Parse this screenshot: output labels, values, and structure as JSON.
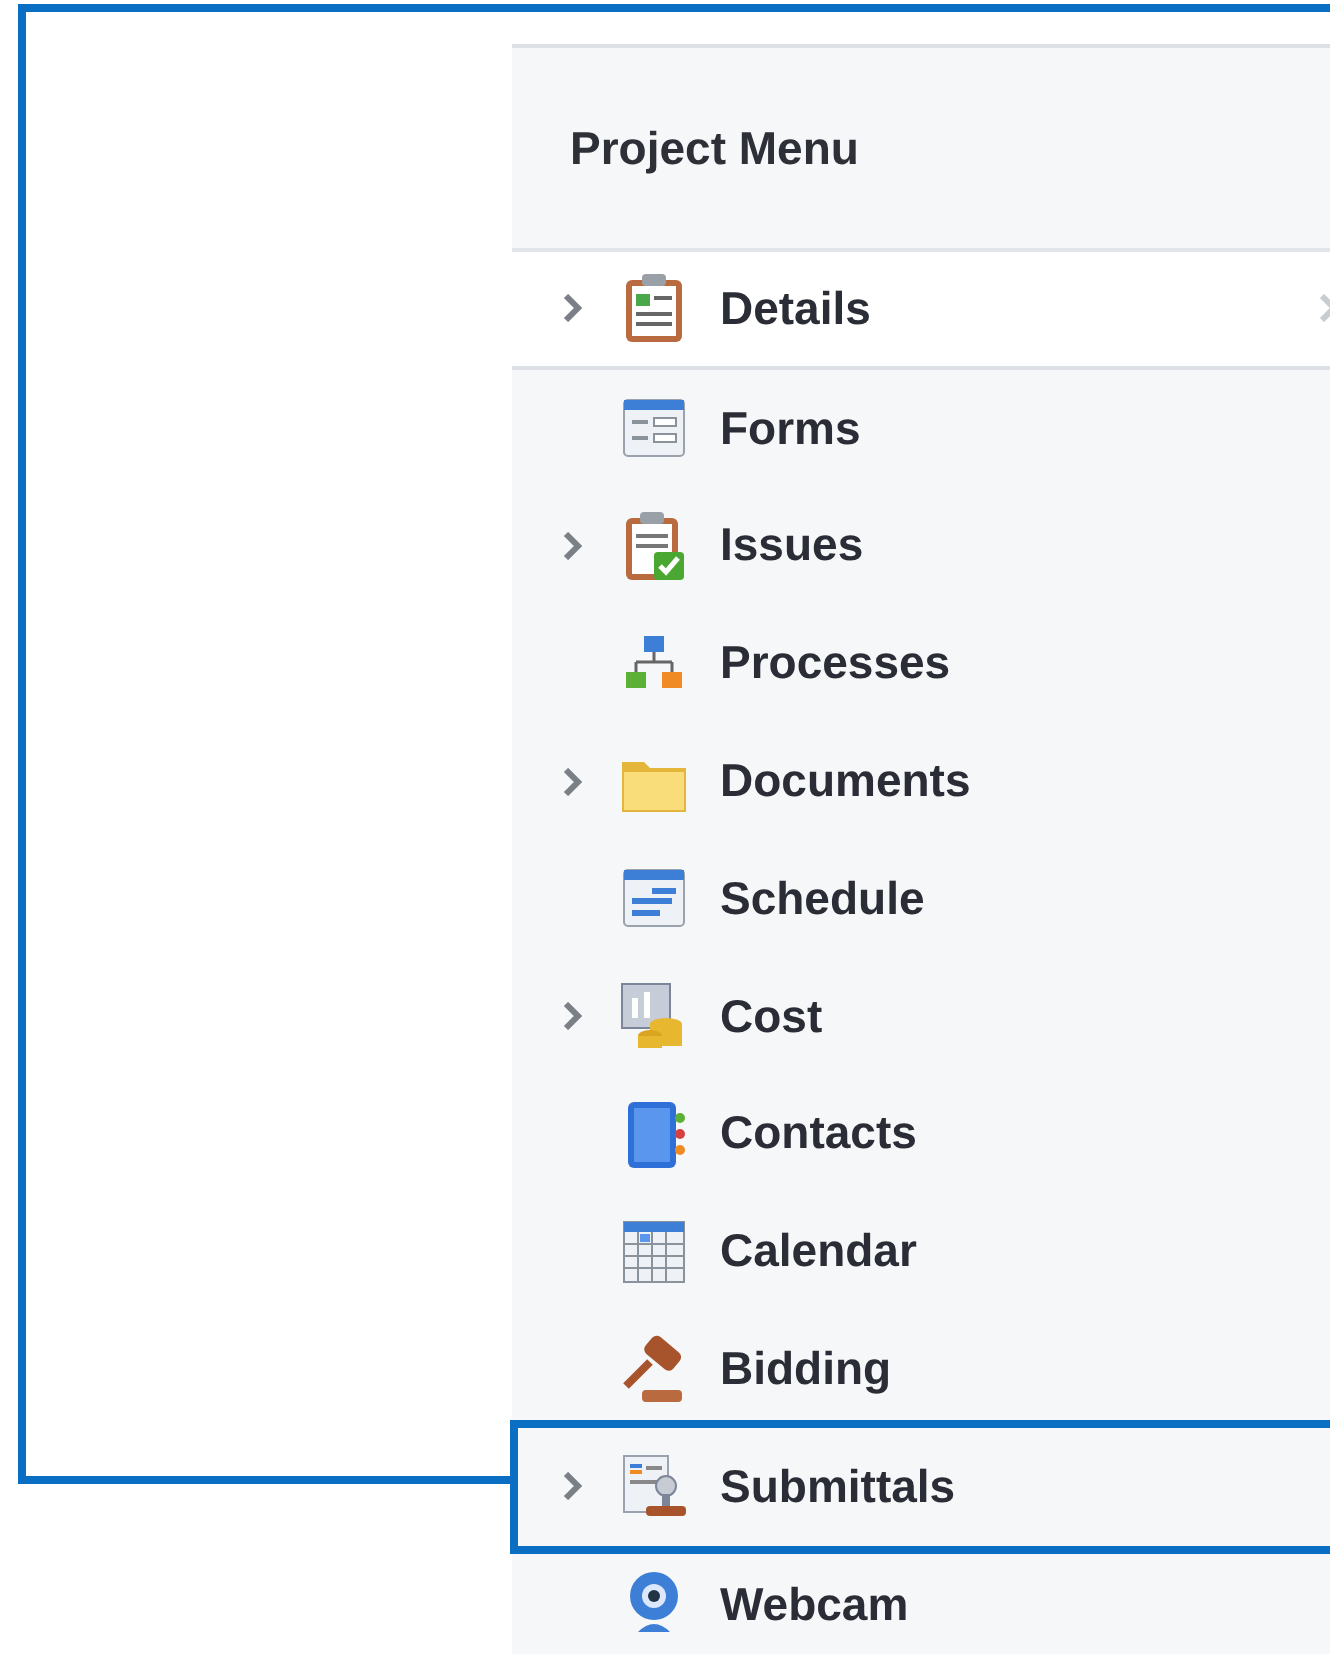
{
  "panel": {
    "title": "Project Menu"
  },
  "items": [
    {
      "label": "Details",
      "kind": "details",
      "expandable": true,
      "selected": true,
      "highlighted": false
    },
    {
      "label": "Forms",
      "kind": "forms",
      "expandable": false,
      "selected": false,
      "highlighted": false
    },
    {
      "label": "Issues",
      "kind": "issues",
      "expandable": true,
      "selected": false,
      "highlighted": false
    },
    {
      "label": "Processes",
      "kind": "processes",
      "expandable": false,
      "selected": false,
      "highlighted": false
    },
    {
      "label": "Documents",
      "kind": "documents",
      "expandable": true,
      "selected": false,
      "highlighted": false
    },
    {
      "label": "Schedule",
      "kind": "schedule",
      "expandable": false,
      "selected": false,
      "highlighted": false
    },
    {
      "label": "Cost",
      "kind": "cost",
      "expandable": true,
      "selected": false,
      "highlighted": false
    },
    {
      "label": "Contacts",
      "kind": "contacts",
      "expandable": false,
      "selected": false,
      "highlighted": false
    },
    {
      "label": "Calendar",
      "kind": "calendar",
      "expandable": false,
      "selected": false,
      "highlighted": false
    },
    {
      "label": "Bidding",
      "kind": "bidding",
      "expandable": false,
      "selected": false,
      "highlighted": false
    },
    {
      "label": "Submittals",
      "kind": "submittals",
      "expandable": true,
      "selected": false,
      "highlighted": true
    },
    {
      "label": "Webcam",
      "kind": "webcam",
      "expandable": false,
      "selected": false,
      "highlighted": false
    }
  ]
}
